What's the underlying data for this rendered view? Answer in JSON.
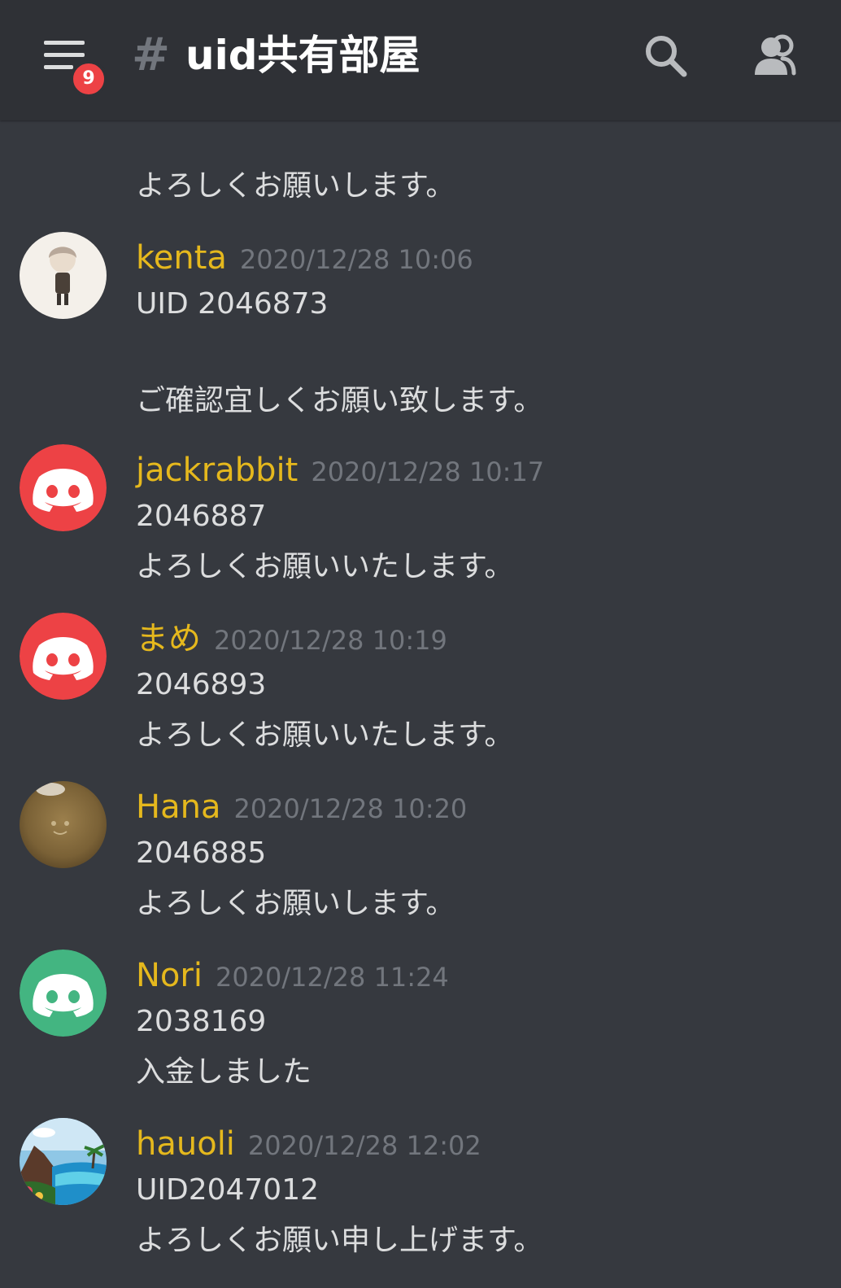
{
  "header": {
    "menu_badge": "9",
    "channel_prefix": "#",
    "channel_name": "uid共有部屋"
  },
  "colors": {
    "background": "#36393f",
    "header_bg": "#2f3136",
    "username": "#e5b81d",
    "timestamp": "#72767d",
    "message_text": "#dcddde",
    "badge": "#ed4245",
    "avatar_red": "#ed4245",
    "avatar_green": "#43b581"
  },
  "icons": {
    "menu": "hamburger-menu-icon",
    "search": "search-icon",
    "members": "members-icon"
  },
  "messages": {
    "continued_1": "よろしくお願いします。",
    "m0": {
      "author": "kenta",
      "timestamp": "2020/12/28 10:06",
      "lines": [
        "UID  2046873",
        "ご確認宜しくお願い致します。"
      ],
      "avatar": "custom-photo-anime-boy"
    },
    "m1": {
      "author": "jackrabbit",
      "timestamp": "2020/12/28 10:17",
      "lines": [
        "2046887",
        "よろしくお願いいたします。"
      ],
      "avatar": "default-discord-red"
    },
    "m2": {
      "author": "まめ",
      "timestamp": "2020/12/28 10:19",
      "lines": [
        "2046893",
        "よろしくお願いいたします。"
      ],
      "avatar": "default-discord-red"
    },
    "m3": {
      "author": "Hana",
      "timestamp": "2020/12/28 10:20",
      "lines": [
        "2046885",
        "よろしくお願いします。"
      ],
      "avatar": "custom-photo-brown"
    },
    "m4": {
      "author": "Nori",
      "timestamp": "2020/12/28 11:24",
      "lines": [
        "2038169",
        "入金しました"
      ],
      "avatar": "default-discord-green"
    },
    "m5": {
      "author": "hauoli",
      "timestamp": "2020/12/28 12:02",
      "lines": [
        "UID2047012",
        "よろしくお願い申し上げます。"
      ],
      "avatar": "custom-photo-beach"
    }
  }
}
